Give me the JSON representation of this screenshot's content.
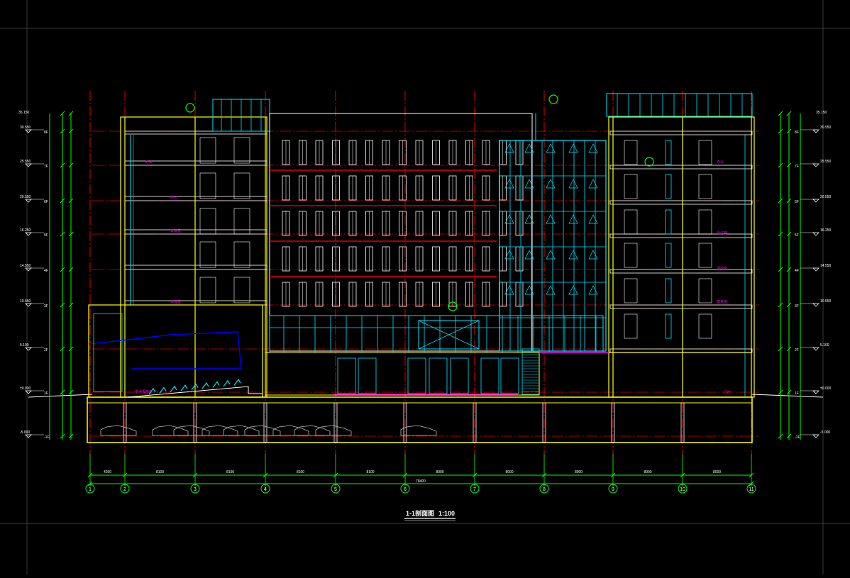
{
  "drawing": {
    "title": "1-1剖面图",
    "scale": "1:100"
  },
  "axes": [
    "1",
    "2",
    "3",
    "4",
    "5",
    "6",
    "7",
    "8",
    "9",
    "10",
    "11"
  ],
  "dimensions": {
    "spans": [
      "4200",
      "8100",
      "8100",
      "8100",
      "8100",
      "8000",
      "8000",
      "8000",
      "8000",
      "8000"
    ],
    "total": "78400"
  },
  "levels_left": [
    {
      "label": "8F",
      "elev": "30.550"
    },
    {
      "label": "7F",
      "elev": "25.550"
    },
    {
      "label": "6F",
      "elev": "20.550"
    },
    {
      "label": "5F",
      "elev": "16.250"
    },
    {
      "label": "4F",
      "elev": "14.550"
    },
    {
      "label": "3F",
      "elev": "10.550"
    },
    {
      "label": "2F",
      "elev": "5.100"
    },
    {
      "label": "1F",
      "elev": "±0.000"
    },
    {
      "label": "-1F",
      "elev": "-5.000"
    }
  ],
  "levels_right": [
    {
      "label": "8F",
      "elev": "30.550"
    },
    {
      "label": "7F",
      "elev": "25.550"
    },
    {
      "label": "6F",
      "elev": "20.550"
    },
    {
      "label": "5F",
      "elev": "16.250"
    },
    {
      "label": "4F",
      "elev": "14.550"
    },
    {
      "label": "3F",
      "elev": "10.550"
    },
    {
      "label": "2F",
      "elev": "5.100"
    },
    {
      "label": "1F",
      "elev": "±0.000"
    },
    {
      "label": "-1F",
      "elev": "-5.000"
    }
  ],
  "top_elev_left": "35.150",
  "top_elev_right": "35.150",
  "room_labels_left": [
    "办公",
    "办公",
    "会议室",
    "会议室",
    "多功能厅"
  ],
  "room_labels_right": [
    "办公",
    "会议室",
    "活动室",
    "健身房",
    "门厅"
  ],
  "seating_label": "学术报告厅",
  "colors": {
    "background": "#000000",
    "axis": "#e00000",
    "dim": "#00ff00",
    "wall": "#ffff00",
    "glass": "#00e5ff",
    "white": "#ffffff",
    "magenta": "#ff00ff",
    "blue": "#0000ff"
  }
}
